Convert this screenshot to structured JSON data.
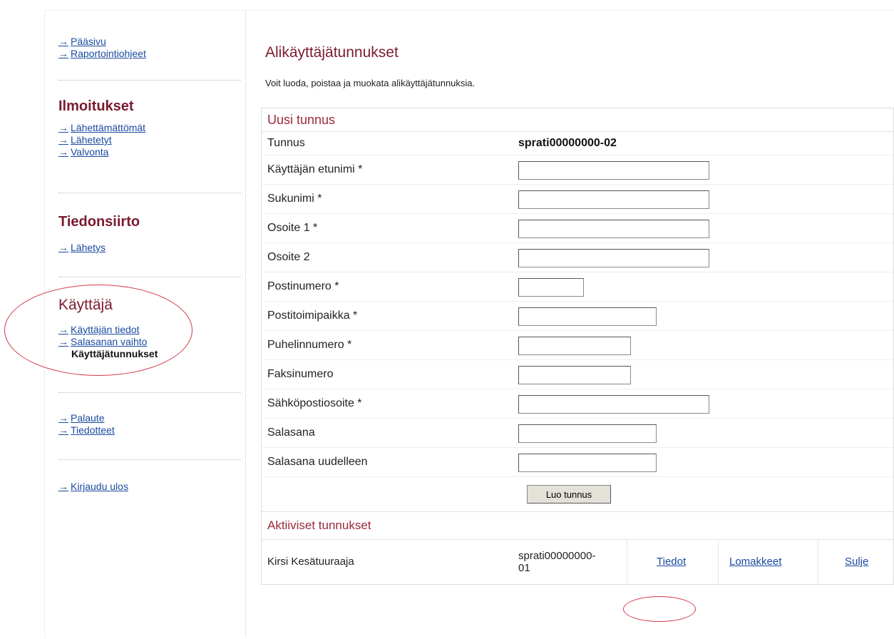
{
  "sidebar": {
    "top_links": [
      "Pääsivu",
      "Raportointiohjeet"
    ],
    "sections": [
      {
        "heading": "Ilmoitukset",
        "links": [
          "Lähettämättömät",
          "Lähetetyt",
          "Valvonta"
        ]
      },
      {
        "heading": "Tiedonsiirto",
        "links": [
          "Lähetys"
        ]
      },
      {
        "heading": "Käyttäjä",
        "links": [
          "Käyttäjän tiedot",
          "Salasanan vaihto"
        ],
        "current": "Käyttäjätunnukset"
      }
    ],
    "bottom_links": [
      "Palaute",
      "Tiedotteet"
    ],
    "logout": "Kirjaudu ulos",
    "arrow": "→"
  },
  "main": {
    "title": "Alikäyttäjätunnukset",
    "intro": "Voit luoda, poistaa ja muokata alikäyttäjätunnuksia."
  },
  "form": {
    "section_title": "Uusi tunnus",
    "tunnus_label": "Tunnus",
    "tunnus_value": "sprati00000000-02",
    "fields": [
      {
        "label": "Käyttäjän etunimi *",
        "value": ""
      },
      {
        "label": "Sukunimi *",
        "value": ""
      },
      {
        "label": "Osoite 1 *",
        "value": ""
      },
      {
        "label": "Osoite 2",
        "value": ""
      },
      {
        "label": "Postinumero *",
        "value": ""
      },
      {
        "label": "Postitoimipaikka *",
        "value": ""
      },
      {
        "label": "Puhelinnumero *",
        "value": ""
      },
      {
        "label": "Faksinumero",
        "value": ""
      },
      {
        "label": "Sähköpostiosoite *",
        "value": ""
      },
      {
        "label": "Salasana",
        "value": ""
      },
      {
        "label": "Salasana uudelleen",
        "value": ""
      }
    ],
    "submit_label": "Luo tunnus"
  },
  "active": {
    "section_title": "Aktiiviset tunnukset",
    "rows": [
      {
        "name": "Kirsi Kesätuuraaja",
        "id_line1": "sprati00000000-",
        "id_line2": "01",
        "info_link": "Tiedot",
        "forms_link": "Lomakkeet",
        "close_link": "Sulje"
      }
    ]
  },
  "colors": {
    "accent": "#7a1b2e",
    "link": "#1a4aa0",
    "annotation": "#d23a4a"
  }
}
